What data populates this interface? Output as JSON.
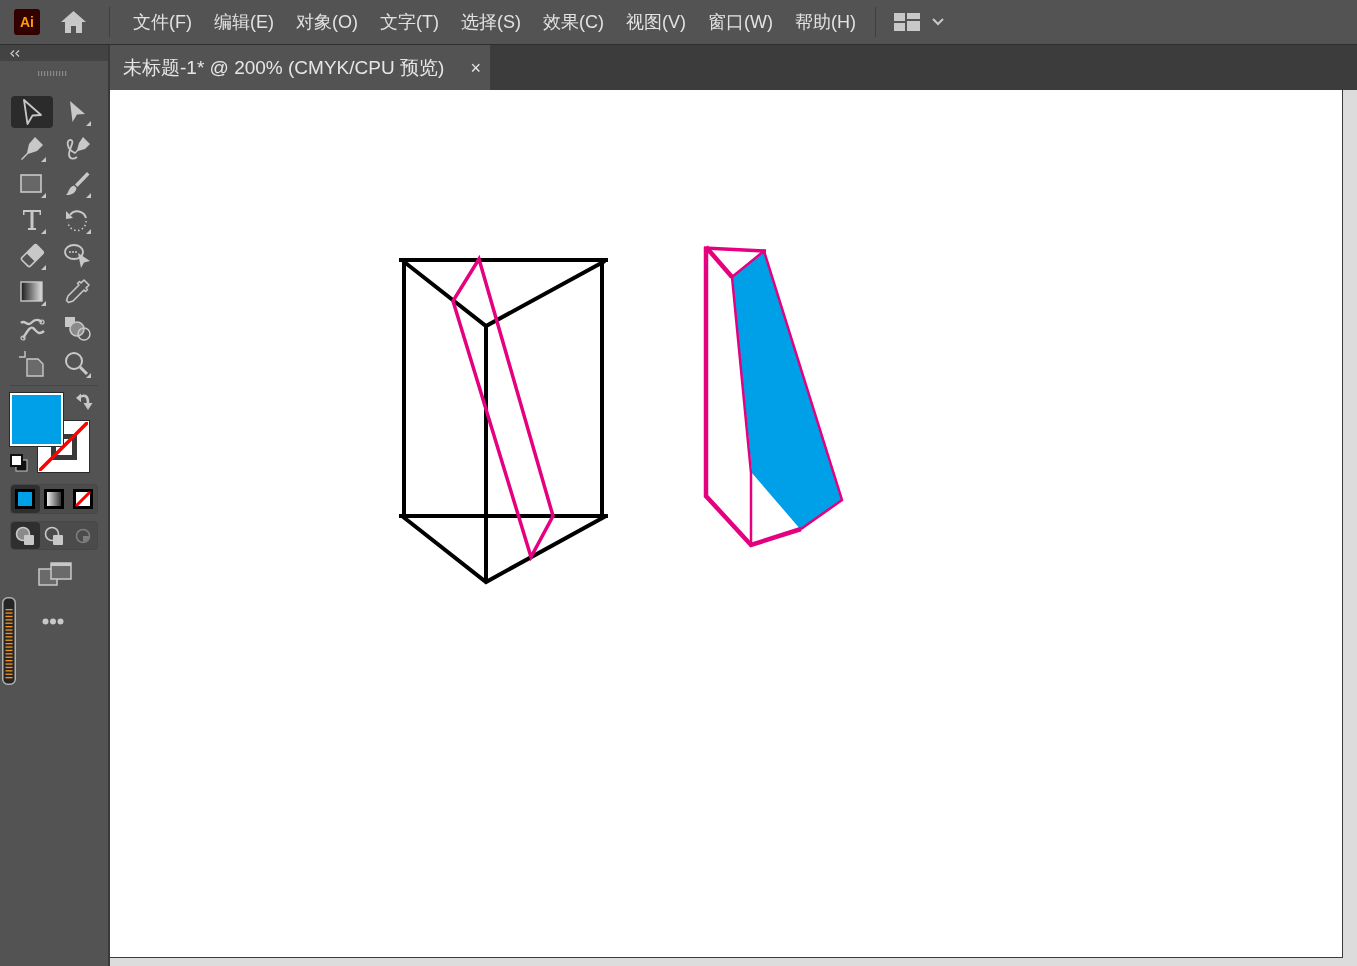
{
  "menu_bar": {
    "logo": "Ai",
    "menus": [
      "文件(F)",
      "编辑(E)",
      "对象(O)",
      "文字(T)",
      "选择(S)",
      "效果(C)",
      "视图(V)",
      "窗口(W)",
      "帮助(H)"
    ]
  },
  "document_tabs": [
    {
      "title": "未标题-1* @ 200% (CMYK/CPU 预览)",
      "close": "×",
      "selected": true
    }
  ],
  "toolbar": {
    "tools": [
      {
        "kind": "selection",
        "selected": true
      },
      {
        "kind": "direct-selection",
        "selected": false
      },
      {
        "kind": "pen",
        "selected": false
      },
      {
        "kind": "curvature",
        "selected": false
      },
      {
        "kind": "rectangle",
        "selected": false
      },
      {
        "kind": "paintbrush",
        "selected": false
      },
      {
        "kind": "type",
        "selected": false
      },
      {
        "kind": "rotate",
        "selected": false
      },
      {
        "kind": "eraser",
        "selected": false
      },
      {
        "kind": "lasso",
        "selected": false
      },
      {
        "kind": "gradient",
        "selected": false
      },
      {
        "kind": "eyedropper",
        "selected": false
      },
      {
        "kind": "puppet-warp",
        "selected": false
      },
      {
        "kind": "shape-builder",
        "selected": false
      },
      {
        "kind": "artboard",
        "selected": false
      },
      {
        "kind": "zoom",
        "selected": false
      }
    ],
    "fill_stroke": {
      "stroke_none": true
    },
    "color_modes": [
      {
        "kind": "color",
        "selected": true
      },
      {
        "kind": "gradient",
        "selected": false
      },
      {
        "kind": "none",
        "selected": false
      }
    ],
    "draw_modes": [
      {
        "kind": "normal",
        "selected": true,
        "disabled": false
      },
      {
        "kind": "behind",
        "selected": false,
        "disabled": false
      },
      {
        "kind": "inside",
        "selected": false,
        "disabled": true
      }
    ]
  }
}
